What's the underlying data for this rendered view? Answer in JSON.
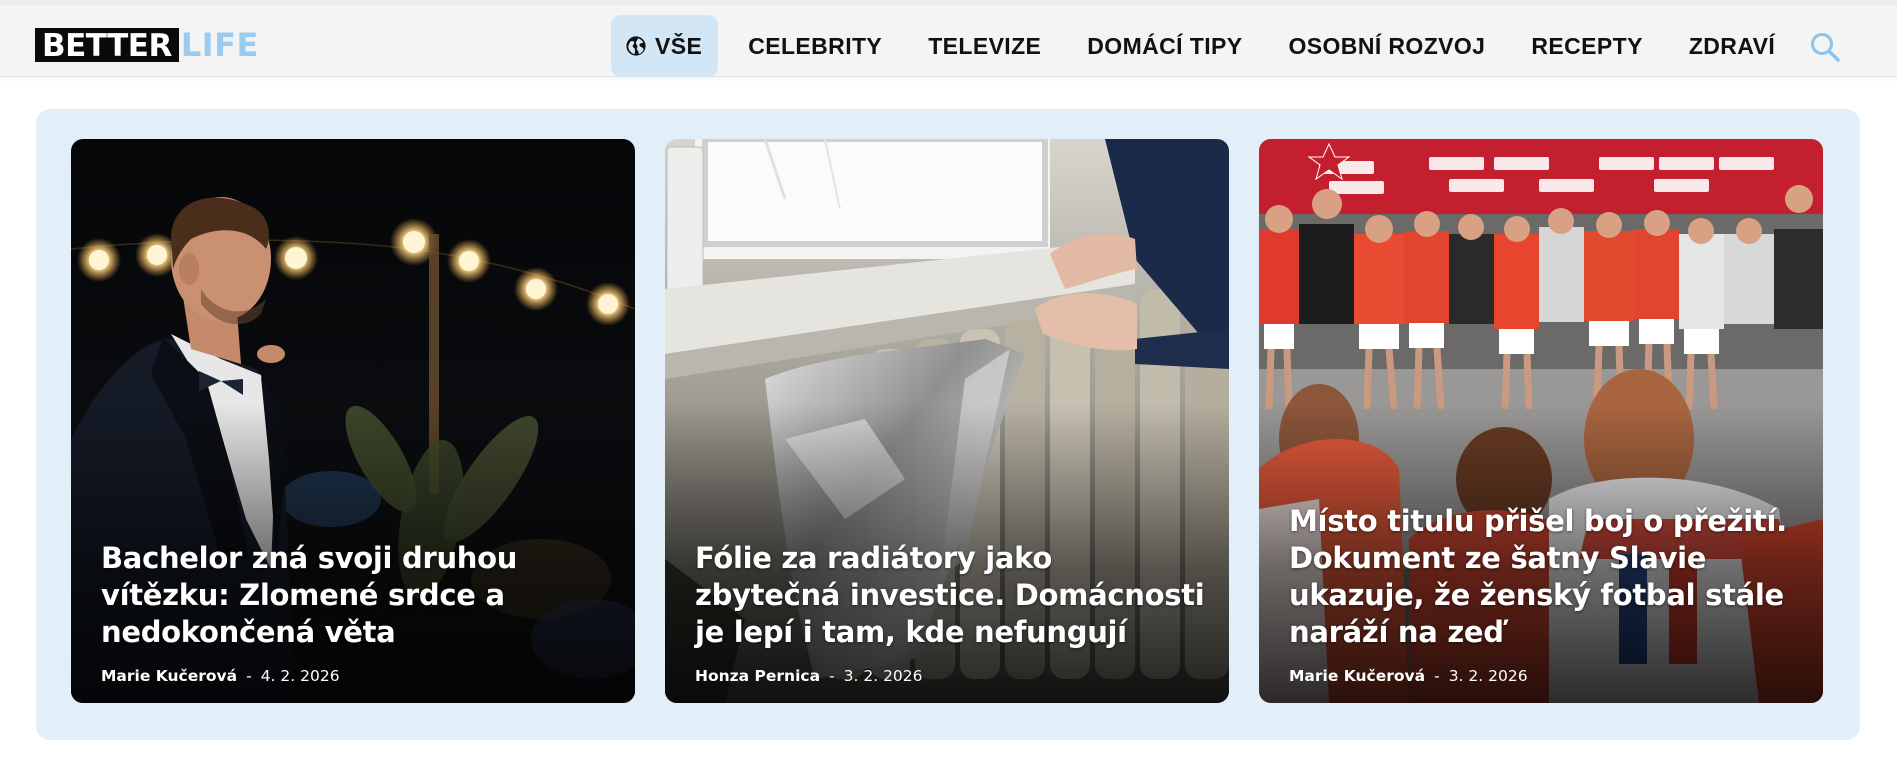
{
  "logo": {
    "brand_dark": "BETTER",
    "brand_light": "LIFE"
  },
  "nav": {
    "active": {
      "label": "VŠE",
      "icon": "globe-icon"
    },
    "items": [
      {
        "label": "CELEBRITY"
      },
      {
        "label": "TELEVIZE"
      },
      {
        "label": "DOMÁCÍ TIPY"
      },
      {
        "label": "OSOBNÍ ROZVOJ"
      },
      {
        "label": "RECEPTY"
      },
      {
        "label": "ZDRAVÍ"
      }
    ],
    "search_icon": "search-icon"
  },
  "colors": {
    "accent": "#9ccbf0",
    "active_tab_bg": "#d3e6f6",
    "panel_bg": "#e3eff8",
    "header_bg": "#f4f4f4"
  },
  "articles": [
    {
      "title": "Bachelor zná svoji druhou vítězku: Zlomené srdce a nedokončená věta",
      "author": "Marie Kučerová",
      "separator": "-",
      "date": "4. 2. 2026"
    },
    {
      "title": "Fólie za radiátory jako zbytečná investice. Domácnosti je lepí i tam, kde nefungují",
      "author": "Honza Pernica",
      "separator": "-",
      "date": "3. 2. 2026"
    },
    {
      "title": "Místo titulu přišel boj o přežití. Dokument ze šatny Slavie ukazuje, že ženský fotbal stále naráží na zeď",
      "author": "Marie Kučerová",
      "separator": "-",
      "date": "3. 2. 2026"
    }
  ]
}
